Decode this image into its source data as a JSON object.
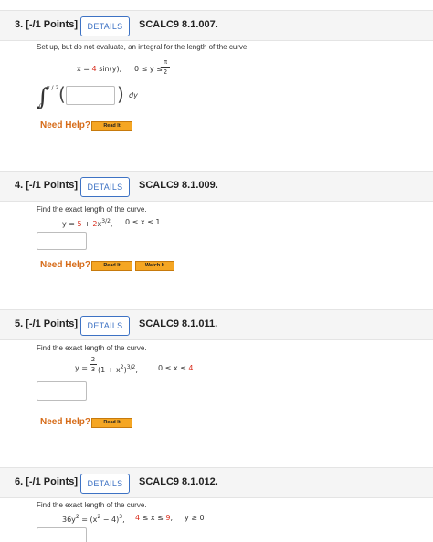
{
  "labels": {
    "details": "DETAILS",
    "need_help": "Need Help?",
    "read_it": "Read It",
    "watch_it": "Watch It"
  },
  "q3": {
    "number": "3. [-/1 Points]",
    "code": "SCALC9 8.1.007.",
    "prompt": "Set up, but do not evaluate, an integral for the length of the curve.",
    "eq_prefix": "x = ",
    "eq_coef": "4",
    "eq_suffix": " sin(y),",
    "range": "0 ≤ y ≤",
    "range_num": "π",
    "range_den": "2",
    "int_upper": "π / 2",
    "int_lower": "0",
    "dy": "dy"
  },
  "q4": {
    "number": "4. [-/1 Points]",
    "code": "SCALC9 8.1.009.",
    "prompt": "Find the exact length of the curve.",
    "eq_a": "y = ",
    "eq_b": "5",
    "eq_c": " + ",
    "eq_d": "2",
    "eq_e": "x",
    "eq_exp": "3/2",
    "eq_f": ",",
    "range": "0 ≤ x ≤ 1"
  },
  "q5": {
    "number": "5. [-/1 Points]",
    "code": "SCALC9 8.1.011.",
    "prompt": "Find the exact length of the curve.",
    "eq_a": "y = ",
    "frac_num": "2",
    "frac_den": "3",
    "eq_b": "(1 + x",
    "eq_exp1": "2",
    "eq_c": ")",
    "eq_exp2": "3/2",
    "eq_d": ",",
    "range_a": "0 ≤ x ≤ ",
    "range_b": "4"
  },
  "q6": {
    "number": "6. [-/1 Points]",
    "code": "SCALC9 8.1.012.",
    "prompt": "Find the exact length of the curve.",
    "eq_a": "36y",
    "eq_exp1": "2",
    "eq_b": " = (x",
    "eq_exp2": "2",
    "eq_c": " − 4)",
    "eq_exp3": "3",
    "eq_d": ",",
    "range_a": "4",
    "range_b": " ≤ x ≤ ",
    "range_c": "9",
    "range_d": ",",
    "cond": "y ≥ 0"
  },
  "colors": {
    "accent": "#3d72c4",
    "highlight": "#d92f1f",
    "help": "#d66b18",
    "button": "#f5a623"
  }
}
